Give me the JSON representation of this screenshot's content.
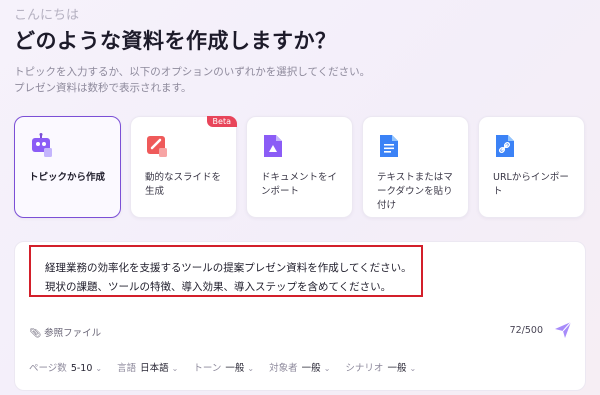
{
  "header": {
    "greeting": "こんにちは",
    "title": "どのような資料を作成しますか？",
    "subtitle_line1": "トピックを入力するか、以下のオプションのいずれかを選択してください。",
    "subtitle_line2": "プレゼン資料は数秒で表示されます。"
  },
  "cards": [
    {
      "label": "トピックから作成",
      "icon": "robot-icon",
      "selected": true
    },
    {
      "label": "動的なスライドを生成",
      "icon": "slides-icon",
      "badge": "Beta"
    },
    {
      "label": "ドキュメントをインポート",
      "icon": "drive-file-icon"
    },
    {
      "label": "テキストまたはマークダウンを貼り付け",
      "icon": "text-doc-icon"
    },
    {
      "label": "URLからインポート",
      "icon": "link-doc-icon"
    }
  ],
  "prompt": {
    "line1": "経理業務の効率化を支援するツールの提案プレゼン資料を作成してください。",
    "line2": "現状の課題、ツールの特徴、導入効果、導入ステップを含めてください。",
    "ref_file_label": "参照ファイル",
    "counter": "72/500"
  },
  "options": [
    {
      "label": "ページ数",
      "value": "5-10"
    },
    {
      "label": "言語",
      "value": "日本語"
    },
    {
      "label": "トーン",
      "value": "一般"
    },
    {
      "label": "対象者",
      "value": "一般"
    },
    {
      "label": "シナリオ",
      "value": "一般"
    }
  ],
  "colors": {
    "accent": "#7b4fd6",
    "highlight_border": "#d31f2a",
    "beta_badge": "#e8455a"
  }
}
